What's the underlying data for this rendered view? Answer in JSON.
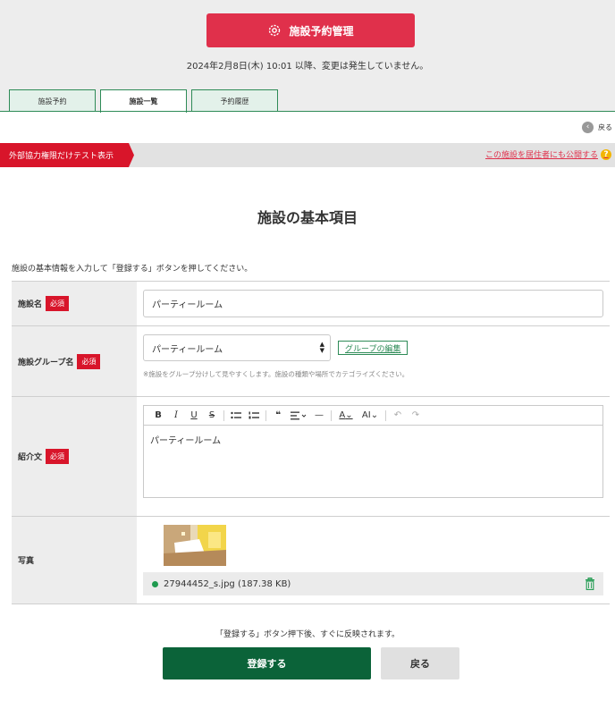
{
  "header": {
    "main_button_label": "施設予約管理",
    "status_text": "2024年2月8日(木) 10:01 以降、変更は発生していません。"
  },
  "tabs": [
    {
      "label": "施設予約",
      "active": false
    },
    {
      "label": "施設一覧",
      "active": true
    },
    {
      "label": "予約履歴",
      "active": false
    }
  ],
  "back_link_label": "戻る",
  "banner": {
    "label": "外部協力権限だけテスト表示",
    "public_link": "この施設を居住者にも公開する",
    "help_icon": "?"
  },
  "section_title": "施設の基本項目",
  "intro_text": "施設の基本情報を入力して「登録する」ボタンを押してください。",
  "required_badge": "必須",
  "form": {
    "name": {
      "label": "施設名",
      "value": "パーティールーム"
    },
    "group": {
      "label": "施設グループ名",
      "selected": "パーティールーム",
      "edit_button": "グループの編集",
      "help": "※施設をグループ分けして見やすくします。施設の種類や場所でカテゴライズください。"
    },
    "intro": {
      "label": "紹介文",
      "content": "パーティールーム",
      "toolbar": {
        "bold": "B",
        "italic": "I",
        "underline": "U",
        "strike": "S",
        "quote": "❝",
        "hr": "—",
        "font_color": "A",
        "font_size": "AI"
      }
    },
    "photo": {
      "label": "写真",
      "file_name": "27944452_s.jpg (187.38 KB)"
    }
  },
  "footer": {
    "note": "「登録する」ボタン押下後、すぐに反映されます。",
    "register_button": "登録する",
    "back_button": "戻る"
  },
  "colors": {
    "primary_red": "#e0304b",
    "required_red": "#d8152a",
    "green": "#0b6339",
    "tab_green": "#2e8b57"
  }
}
